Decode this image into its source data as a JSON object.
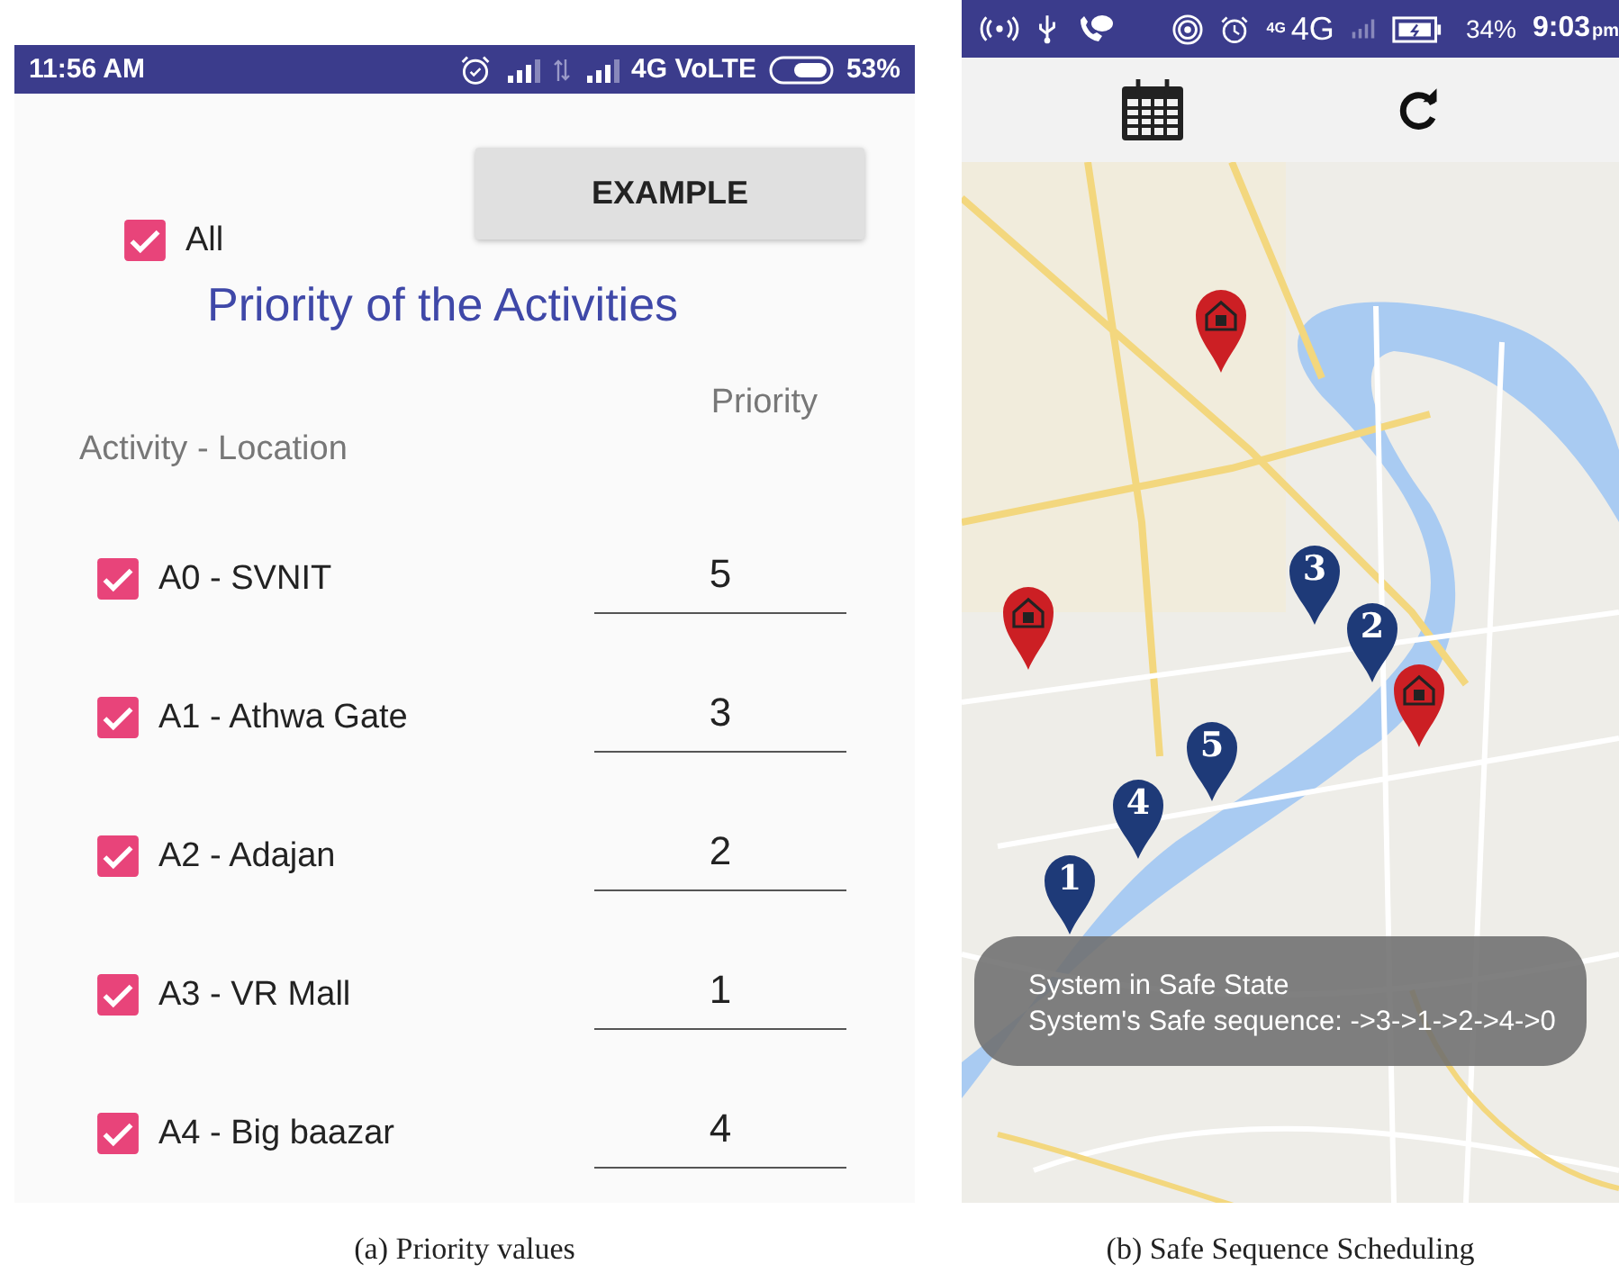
{
  "panels": [
    {
      "kind": "priority",
      "status_bar": {
        "time": "11:56 AM",
        "network": "4G VoLTE",
        "battery": "53%"
      },
      "example_button": "EXAMPLE",
      "all_checkbox": {
        "label": "All",
        "checked": true
      },
      "title": "Priority of the Activities",
      "priority_heading": "Priority",
      "activity_heading": "Activity - Location",
      "activities": [
        {
          "label": "A0 - SVNIT",
          "checked": true,
          "priority": "5"
        },
        {
          "label": "A1 - Athwa Gate",
          "checked": true,
          "priority": "3"
        },
        {
          "label": "A2 - Adajan",
          "checked": true,
          "priority": "2"
        },
        {
          "label": "A3 - VR Mall",
          "checked": true,
          "priority": "1"
        },
        {
          "label": "A4 - Big baazar",
          "checked": true,
          "priority": "4"
        }
      ],
      "caption": "(a)  Priority values"
    },
    {
      "kind": "map",
      "status_bar": {
        "network_small": "4G",
        "network": "4G",
        "battery": "34%",
        "time": "9:03",
        "time_suffix": "pm"
      },
      "markers": [
        {
          "kind": "home"
        },
        {
          "kind": "home"
        },
        {
          "kind": "home"
        },
        {
          "kind": "number",
          "label": "3"
        },
        {
          "kind": "number",
          "label": "2"
        },
        {
          "kind": "number",
          "label": "5"
        },
        {
          "kind": "number",
          "label": "4"
        },
        {
          "kind": "number",
          "label": "1"
        }
      ],
      "toast": {
        "lines": [
          "System in Safe State",
          "System's Safe sequence: ->3->1->2->4->0"
        ]
      },
      "caption": "(b)  Safe Sequence Scheduling"
    }
  ]
}
